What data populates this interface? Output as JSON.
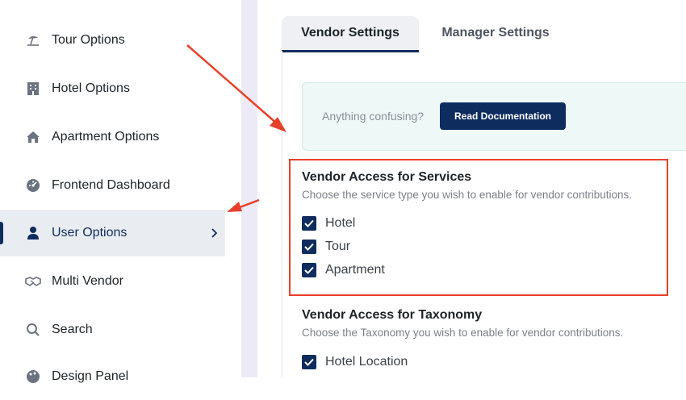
{
  "sidebar": {
    "items": [
      {
        "label": "Tour Options",
        "icon": "beach-umbrella-icon"
      },
      {
        "label": "Hotel Options",
        "icon": "building-icon"
      },
      {
        "label": "Apartment Options",
        "icon": "home-icon"
      },
      {
        "label": "Frontend Dashboard",
        "icon": "dashboard-gauge-icon"
      },
      {
        "label": "User Options",
        "icon": "user-icon",
        "active": true
      },
      {
        "label": "Multi Vendor",
        "icon": "handshake-icon"
      },
      {
        "label": "Search",
        "icon": "search-icon"
      },
      {
        "label": "Design Panel",
        "icon": "palette-icon"
      }
    ]
  },
  "tabs": [
    {
      "label": "Vendor Settings",
      "active": true
    },
    {
      "label": "Manager Settings",
      "active": false
    }
  ],
  "notice": {
    "text": "Anything confusing?",
    "button_label": "Read Documentation"
  },
  "sections": [
    {
      "title": "Vendor Access for Services",
      "description": "Choose the service type you wish to enable for vendor contributions.",
      "options": [
        {
          "label": "Hotel",
          "checked": true
        },
        {
          "label": "Tour",
          "checked": true
        },
        {
          "label": "Apartment",
          "checked": true
        }
      ]
    },
    {
      "title": "Vendor Access for Taxonomy",
      "description": "Choose the Taxonomy you wish to enable for vendor contributions.",
      "options": [
        {
          "label": "Hotel Location",
          "checked": true
        }
      ]
    }
  ],
  "colors": {
    "brand": "#0f2c5e",
    "annotation": "#e8402a",
    "notice_bg": "#eef8f7",
    "divider": "#eceaf7"
  }
}
